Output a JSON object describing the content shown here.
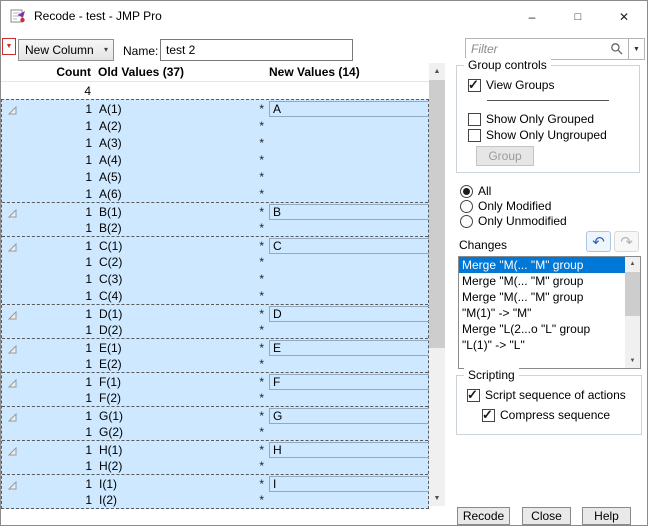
{
  "window": {
    "title": "Recode - test - JMP Pro",
    "minimize_glyph": "–",
    "maximize_glyph": "□",
    "close_glyph": "✕"
  },
  "icons": {
    "red_triangle": "▼",
    "combo_arrow": "▾",
    "filter_arrow": "▼",
    "scroll_up": "▲",
    "scroll_down": "▼",
    "undo": "↶",
    "redo": "↷"
  },
  "toolbar": {
    "column_mode": "New Column",
    "name_label": "Name:",
    "name_value": "test 2",
    "filter_placeholder": "Filter"
  },
  "table": {
    "headers": {
      "count": "Count",
      "old_values": "Old Values (37)",
      "new_values": "New Values (14)"
    },
    "rows": [
      {
        "count": "4",
        "old_value": "",
        "star": "",
        "new_value": "",
        "group_header": false,
        "selected": false
      },
      {
        "count": "1",
        "old_value": "A(1)",
        "star": "*",
        "new_value": "A",
        "group_header": true,
        "selected": true
      },
      {
        "count": "1",
        "old_value": "A(2)",
        "star": "*",
        "new_value": "",
        "group_header": false,
        "selected": true
      },
      {
        "count": "1",
        "old_value": "A(3)",
        "star": "*",
        "new_value": "",
        "group_header": false,
        "selected": true
      },
      {
        "count": "1",
        "old_value": "A(4)",
        "star": "*",
        "new_value": "",
        "group_header": false,
        "selected": true
      },
      {
        "count": "1",
        "old_value": "A(5)",
        "star": "*",
        "new_value": "",
        "group_header": false,
        "selected": true
      },
      {
        "count": "1",
        "old_value": "A(6)",
        "star": "*",
        "new_value": "",
        "group_header": false,
        "selected": true
      },
      {
        "count": "1",
        "old_value": "B(1)",
        "star": "*",
        "new_value": "B",
        "group_header": true,
        "selected": true
      },
      {
        "count": "1",
        "old_value": "B(2)",
        "star": "*",
        "new_value": "",
        "group_header": false,
        "selected": true
      },
      {
        "count": "1",
        "old_value": "C(1)",
        "star": "*",
        "new_value": "C",
        "group_header": true,
        "selected": true
      },
      {
        "count": "1",
        "old_value": "C(2)",
        "star": "*",
        "new_value": "",
        "group_header": false,
        "selected": true
      },
      {
        "count": "1",
        "old_value": "C(3)",
        "star": "*",
        "new_value": "",
        "group_header": false,
        "selected": true
      },
      {
        "count": "1",
        "old_value": "C(4)",
        "star": "*",
        "new_value": "",
        "group_header": false,
        "selected": true
      },
      {
        "count": "1",
        "old_value": "D(1)",
        "star": "*",
        "new_value": "D",
        "group_header": true,
        "selected": true
      },
      {
        "count": "1",
        "old_value": "D(2)",
        "star": "*",
        "new_value": "",
        "group_header": false,
        "selected": true
      },
      {
        "count": "1",
        "old_value": "E(1)",
        "star": "*",
        "new_value": "E",
        "group_header": true,
        "selected": true
      },
      {
        "count": "1",
        "old_value": "E(2)",
        "star": "*",
        "new_value": "",
        "group_header": false,
        "selected": true
      },
      {
        "count": "1",
        "old_value": "F(1)",
        "star": "*",
        "new_value": "F",
        "group_header": true,
        "selected": true
      },
      {
        "count": "1",
        "old_value": "F(2)",
        "star": "*",
        "new_value": "",
        "group_header": false,
        "selected": true
      },
      {
        "count": "1",
        "old_value": "G(1)",
        "star": "*",
        "new_value": "G",
        "group_header": true,
        "selected": true
      },
      {
        "count": "1",
        "old_value": "G(2)",
        "star": "*",
        "new_value": "",
        "group_header": false,
        "selected": true
      },
      {
        "count": "1",
        "old_value": "H(1)",
        "star": "*",
        "new_value": "H",
        "group_header": true,
        "selected": true
      },
      {
        "count": "1",
        "old_value": "H(2)",
        "star": "*",
        "new_value": "",
        "group_header": false,
        "selected": true
      },
      {
        "count": "1",
        "old_value": "I(1)",
        "star": "*",
        "new_value": "I",
        "group_header": true,
        "selected": true
      },
      {
        "count": "1",
        "old_value": "I(2)",
        "star": "*",
        "new_value": "",
        "group_header": false,
        "selected": true
      }
    ]
  },
  "group_controls": {
    "title": "Group controls",
    "view_groups": {
      "label": "View Groups",
      "checked": true
    },
    "show_only_grouped": {
      "label": "Show Only Grouped",
      "checked": false
    },
    "show_only_ungrouped": {
      "label": "Show Only Ungrouped",
      "checked": false
    },
    "group_button": "Group"
  },
  "view_filter": {
    "options": [
      {
        "label": "All",
        "selected": true
      },
      {
        "label": "Only Modified",
        "selected": false
      },
      {
        "label": "Only Unmodified",
        "selected": false
      }
    ]
  },
  "changes": {
    "title": "Changes",
    "items": [
      {
        "text": "Merge \"M(... \"M\" group",
        "selected": true
      },
      {
        "text": "Merge \"M(... \"M\" group",
        "selected": false
      },
      {
        "text": "Merge \"M(... \"M\" group",
        "selected": false
      },
      {
        "text": "\"M(1)\" -> \"M\"",
        "selected": false
      },
      {
        "text": "Merge \"L(2...o \"L\" group",
        "selected": false
      },
      {
        "text": "\"L(1)\" -> \"L\"",
        "selected": false
      }
    ]
  },
  "scripting": {
    "title": "Scripting",
    "script_sequence": {
      "label": "Script sequence of actions",
      "checked": true
    },
    "compress_sequence": {
      "label": "Compress sequence",
      "checked": true
    }
  },
  "footer": {
    "recode": "Recode",
    "close": "Close",
    "help": "Help"
  }
}
